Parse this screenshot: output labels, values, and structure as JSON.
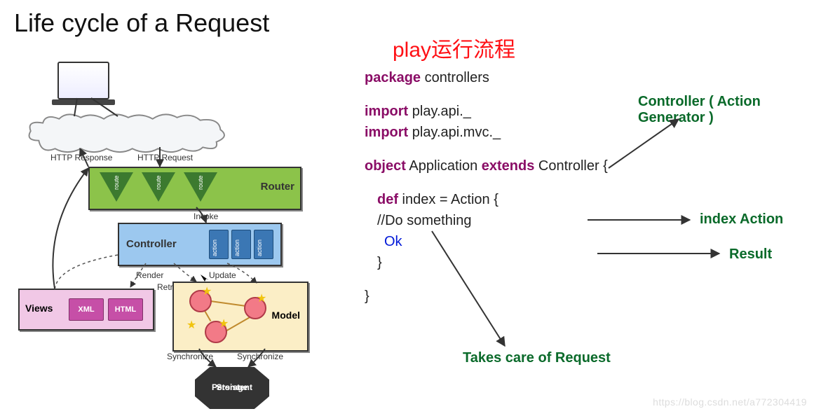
{
  "title": "Life cycle of a Request",
  "subtitle_red": "play运行流程",
  "watermark": "https://blog.csdn.net/a772304419",
  "diagram": {
    "laptop": "client-laptop",
    "http_response": "HTTP Response",
    "http_request": "HTTP Request",
    "router": {
      "label": "Router",
      "triangle_item": "route"
    },
    "invoke": "Invoke",
    "controller": {
      "label": "Controller",
      "slot_item": "action"
    },
    "render": "Render",
    "retrieve": "Retrieve",
    "update": "Update",
    "views": {
      "label": "Views",
      "chip1": "XML",
      "chip2": "HTML"
    },
    "model": {
      "label": "Model"
    },
    "synchronize": "Synchronize",
    "storage_line1": "Persistent",
    "storage_line2": "Storage"
  },
  "code": {
    "kw_package": "package",
    "controllers": " controllers",
    "kw_import": "import",
    "import1": " play.api._",
    "import2": " play.api.mvc._",
    "kw_object": "object",
    "app": " Application ",
    "kw_extends": "extends",
    "ctrl": " Controller {",
    "kw_def": "def",
    "idx": " index = Action {",
    "comment": "//Do something",
    "ok": "Ok",
    "close1": "}",
    "close2": "}"
  },
  "annotations": {
    "controller_ag": "Controller ( Action Generator )",
    "index_action": "index Action",
    "result": "Result",
    "takes_care": "Takes care of Request"
  }
}
